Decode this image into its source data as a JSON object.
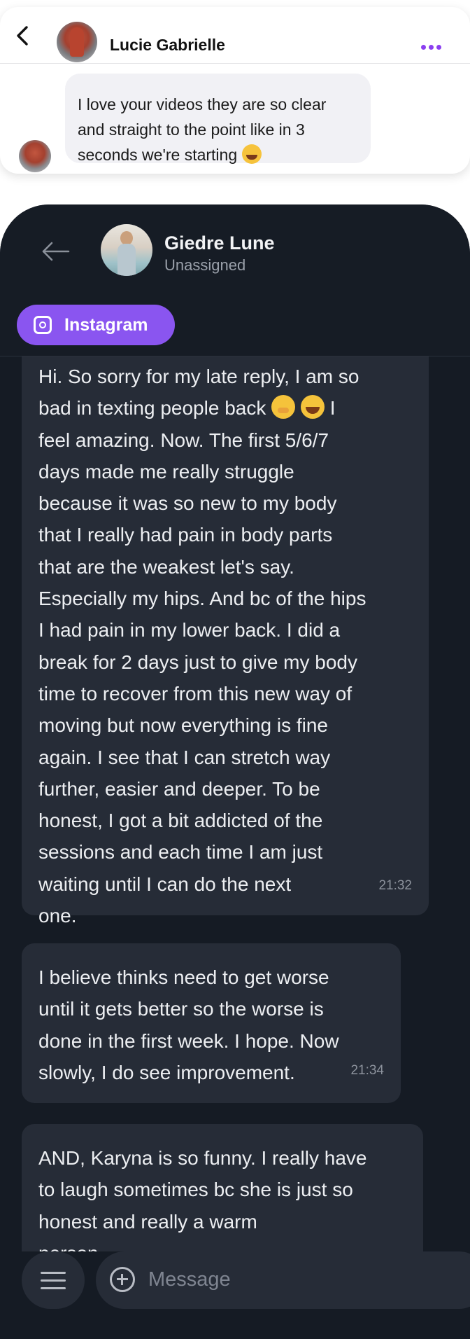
{
  "light_chat": {
    "contact_name": "Lucie Gabrielle",
    "message_text": "I love your videos they are so clear and straight to the point like in 3 seconds we're starting",
    "accent_color": "#8b3ff0"
  },
  "dark_chat": {
    "contact_name": "Giedre Lune",
    "status": "Unassigned",
    "channel": "Instagram",
    "channel_color": "#8a55f0",
    "messages": [
      {
        "text_a": "Hi. So sorry for my late reply, I am so\nbad in texting people back ",
        "text_b": " I\nfeel amazing. Now. The first 5/6/7\ndays made me really struggle\nbecause it was so new to my body\nthat I really had pain in body parts\nthat are the weakest let's say.\nEspecially my hips. And bc of the hips\nI had pain in my lower back. I did a\nbreak for 2 days just to give my body\ntime to recover from this new way of\nmoving but now everything is fine\nagain. I see that I can stretch way\nfurther, easier and deeper. To be\nhonest, I got a bit addicted of the\nsessions and each time I am just\nwaiting until I can do the next\none.",
        "time": "21:32"
      },
      {
        "text": "I believe thinks need to get worse\nuntil it gets better so the worse is\ndone in the first week. I hope. Now\nslowly, I do see improvement.",
        "time": "21:34"
      },
      {
        "text": "AND, Karyna is so funny. I really have\nto laugh sometimes bc she is just so\nhonest and really a warm\nperson."
      }
    ],
    "input_placeholder": "Message"
  }
}
